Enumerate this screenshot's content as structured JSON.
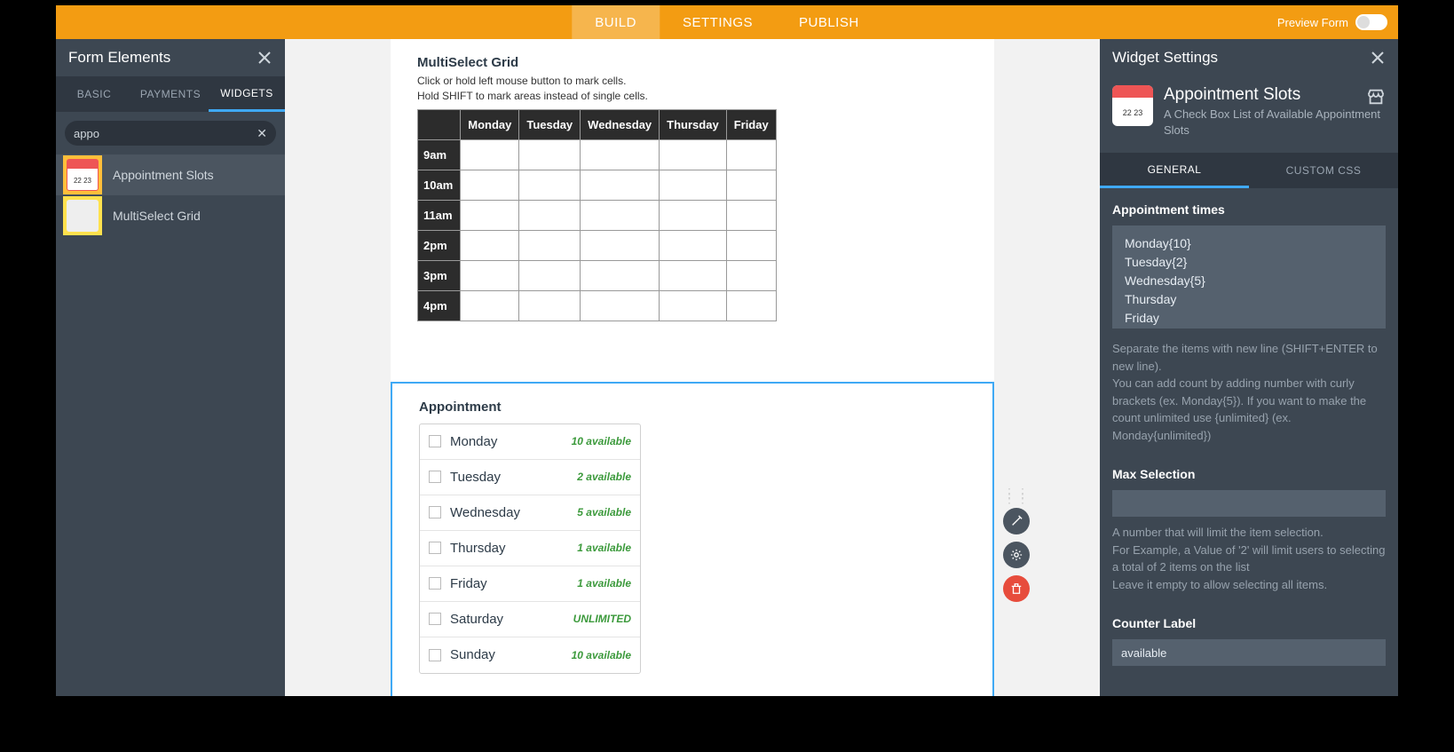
{
  "topbar": {
    "tabs": [
      "BUILD",
      "SETTINGS",
      "PUBLISH"
    ],
    "active": 0,
    "preview_label": "Preview Form"
  },
  "left": {
    "title": "Form Elements",
    "tabs": [
      "BASIC",
      "PAYMENTS",
      "WIDGETS"
    ],
    "active_tab": 2,
    "search_value": "appo",
    "items": [
      {
        "name": "Appointment Slots",
        "icon": "cal"
      },
      {
        "name": "MultiSelect Grid",
        "icon": "grid"
      }
    ],
    "selected_item": 0
  },
  "canvas": {
    "multiselect": {
      "title": "MultiSelect Grid",
      "hint1": "Click or hold left mouse button to mark cells.",
      "hint2": "Hold SHIFT to mark areas instead of single cells.",
      "cols": [
        "Monday",
        "Tuesday",
        "Wednesday",
        "Thursday",
        "Friday"
      ],
      "rows": [
        "9am",
        "10am",
        "11am",
        "2pm",
        "3pm",
        "4pm"
      ]
    },
    "appointment": {
      "title": "Appointment",
      "rows": [
        {
          "day": "Monday",
          "avail": "10 available"
        },
        {
          "day": "Tuesday",
          "avail": "2 available"
        },
        {
          "day": "Wednesday",
          "avail": "5 available"
        },
        {
          "day": "Thursday",
          "avail": "1 available"
        },
        {
          "day": "Friday",
          "avail": "1 available"
        },
        {
          "day": "Saturday",
          "avail": "UNLIMITED"
        },
        {
          "day": "Sunday",
          "avail": "10 available"
        }
      ]
    }
  },
  "right": {
    "title": "Widget Settings",
    "hero_title": "Appointment Slots",
    "hero_sub": "A Check Box List of Available Appointment Slots",
    "tabs": [
      "GENERAL",
      "CUSTOM CSS"
    ],
    "active_tab": 0,
    "appt_times_label": "Appointment times",
    "appt_times_value": "Monday{10}\nTuesday{2}\nWednesday{5}\nThursday\nFriday",
    "appt_times_help": "Separate the items with new line (SHIFT+ENTER to new line).\nYou can add count by adding number with curly brackets (ex. Monday{5}). If you want to make the count unlimited use {unlimited} (ex. Monday{unlimited})",
    "max_sel_label": "Max Selection",
    "max_sel_value": "",
    "max_sel_help": "A number that will limit the item selection.\nFor Example, a Value of '2' will limit users to selecting a total of 2 items on the list\nLeave it empty to allow selecting all items.",
    "counter_label_label": "Counter Label",
    "counter_label_value": "available"
  }
}
